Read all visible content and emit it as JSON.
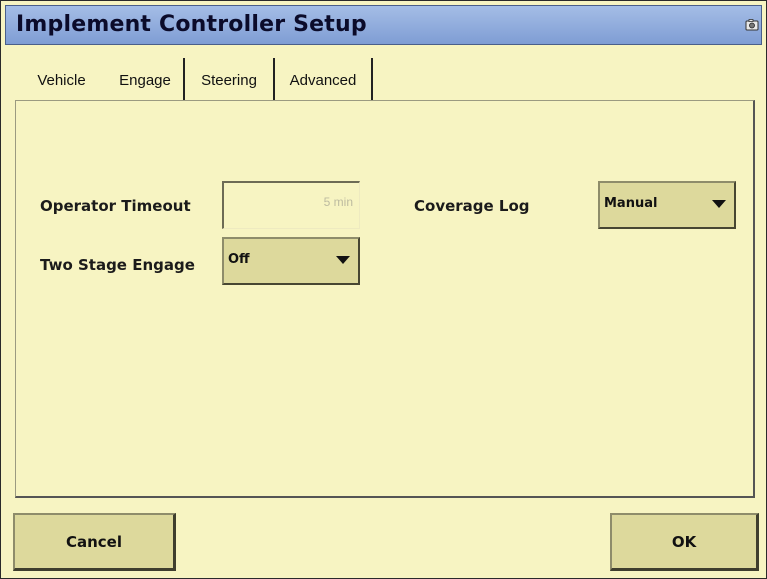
{
  "window": {
    "title": "Implement Controller Setup"
  },
  "tabs": [
    {
      "label": "Vehicle"
    },
    {
      "label": "Engage",
      "active": true
    },
    {
      "label": "Steering"
    },
    {
      "label": "Advanced"
    }
  ],
  "form": {
    "operator_timeout": {
      "label": "Operator Timeout",
      "value": "5 min"
    },
    "two_stage_engage": {
      "label": "Two Stage Engage",
      "value": "Off"
    },
    "coverage_log": {
      "label": "Coverage Log",
      "value": "Manual"
    }
  },
  "buttons": {
    "cancel": "Cancel",
    "ok": "OK"
  },
  "icons": {
    "titlebar_icon": "camera-icon",
    "dropdown_arrow": "chevron-down-icon"
  },
  "colors": {
    "background": "#f7f4c2",
    "titlebar": "#8fa9dc",
    "button": "#ddd99c"
  }
}
